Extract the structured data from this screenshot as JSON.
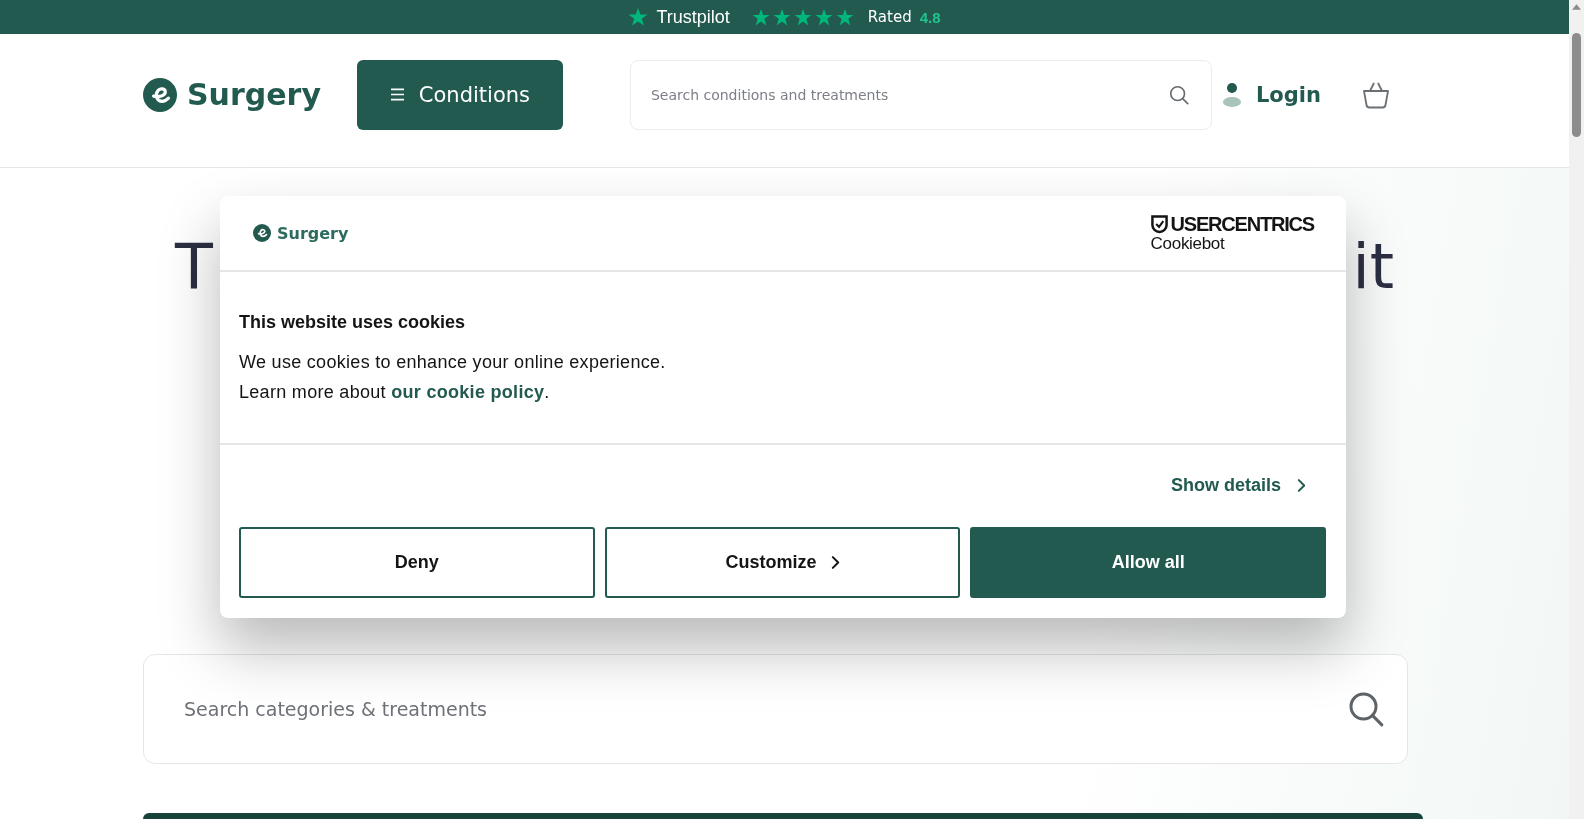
{
  "trustbar": {
    "brand": "Trustpilot",
    "stars": 5,
    "rated_label": "Rated",
    "rating": "4.8"
  },
  "header": {
    "logo": "Surgery",
    "menu_button": "Conditions",
    "search": {
      "placeholder": "Search conditions and treatments"
    },
    "login": "Login"
  },
  "hero": {
    "heading_start": "T",
    "heading_end": "it",
    "search": {
      "placeholder": "Search categories & treatments"
    }
  },
  "cookie_dialog": {
    "logo": "Surgery",
    "vendor": "USERCENTRICS",
    "vendor_product": "Cookiebot",
    "title": "This website uses cookies",
    "text_line_1": "We use cookies to enhance your online experience.",
    "text_before_link": "Learn more about ",
    "link": "our cookie policy",
    "text_after_link": ".",
    "details_link": "Show details",
    "buttons": [
      {
        "label": "Deny",
        "kind": "secondary"
      },
      {
        "label": "Customize",
        "kind": "menu"
      },
      {
        "label": "Allow all",
        "kind": "primary"
      }
    ]
  }
}
